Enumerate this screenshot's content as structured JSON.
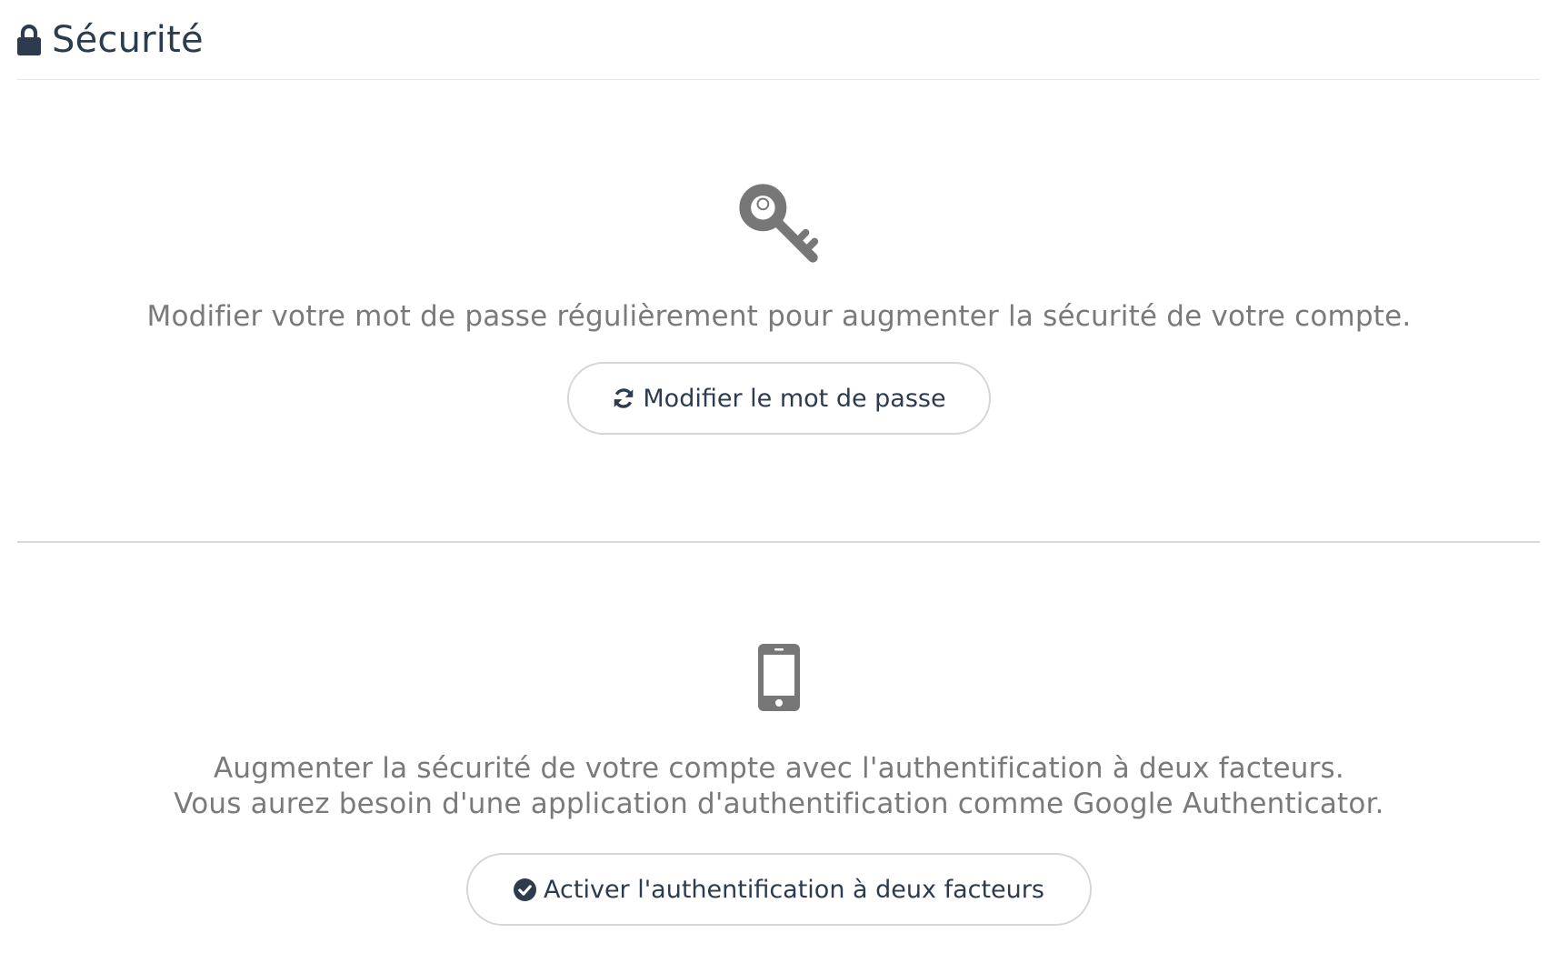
{
  "header": {
    "title": "Sécurité",
    "icon": "lock-icon"
  },
  "password_section": {
    "icon": "key-icon",
    "description": "Modifier votre mot de passe régulièrement pour augmenter la sécurité de votre compte.",
    "button_icon": "refresh-icon",
    "button_label": "Modifier le mot de passe"
  },
  "twofa_section": {
    "icon": "mobile-phone-icon",
    "description_line1": "Augmenter la sécurité de votre compte avec l'authentification à deux facteurs.",
    "description_line2": "Vous aurez besoin d'une application d'authentification comme Google Authenticator.",
    "button_icon": "check-circle-icon",
    "button_label": "Activer l'authentification à deux facteurs"
  },
  "colors": {
    "text_dark": "#2d3b4f",
    "text_muted": "#7a7a7a",
    "icon_gray": "#777777",
    "border": "#d6d6d6"
  }
}
